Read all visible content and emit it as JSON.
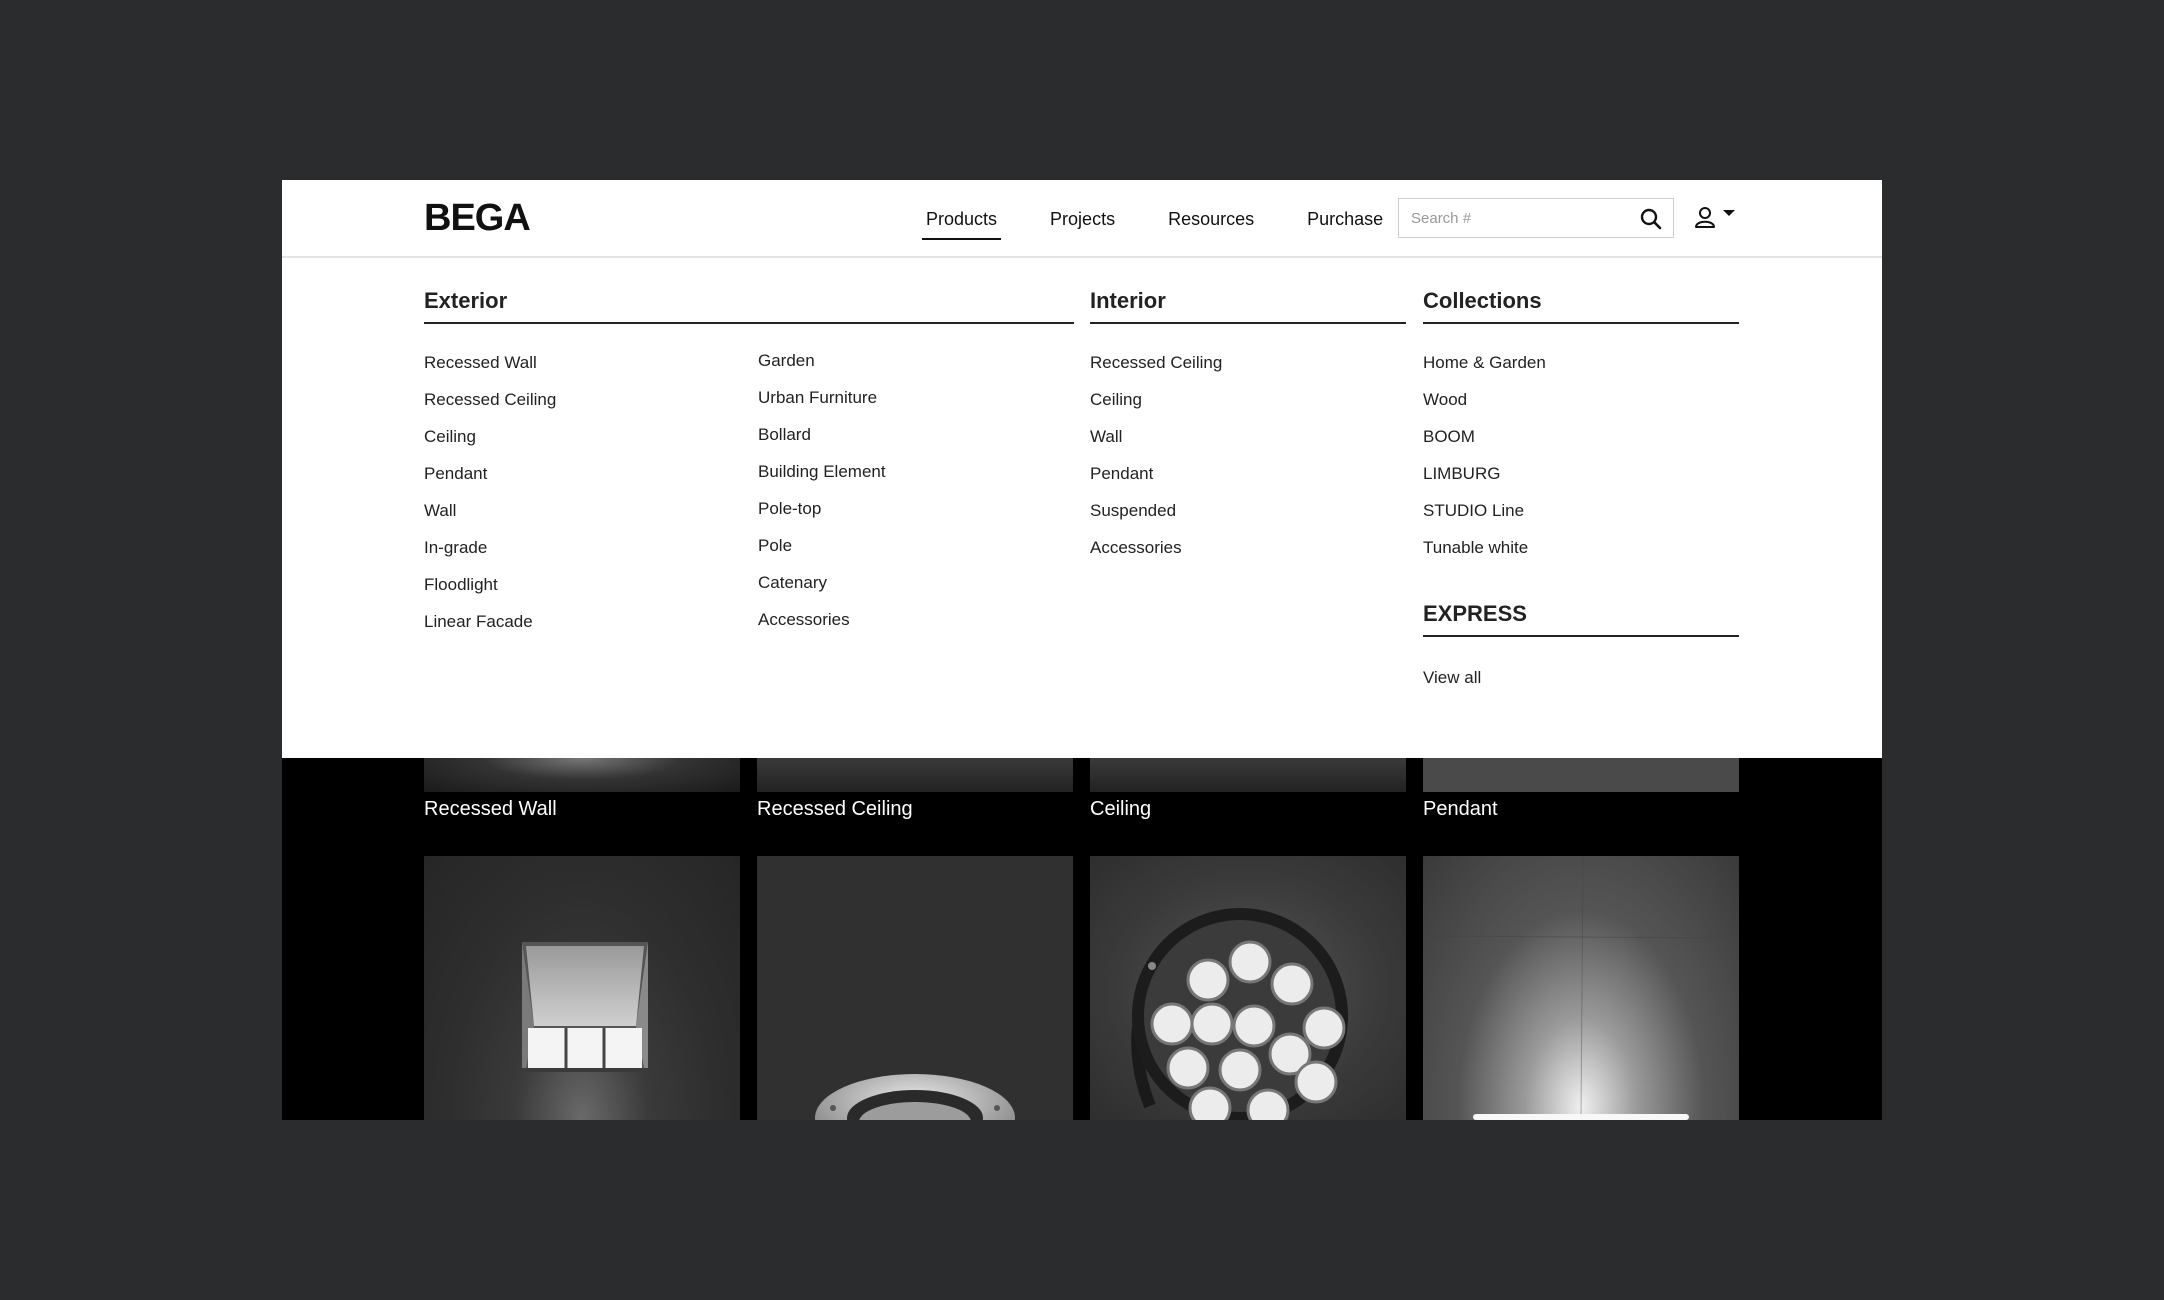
{
  "header": {
    "logo": "BEGA",
    "nav": [
      {
        "label": "Products",
        "active": true
      },
      {
        "label": "Projects",
        "active": false
      },
      {
        "label": "Resources",
        "active": false
      },
      {
        "label": "Purchase",
        "active": false
      }
    ],
    "search": {
      "placeholder": "Search #",
      "value": ""
    },
    "icons": {
      "search": "search-icon",
      "account": "user-icon",
      "dropdown": "caret-down-icon"
    }
  },
  "menu": {
    "exterior": {
      "title": "Exterior",
      "col1": [
        "Recessed Wall",
        "Recessed Ceiling",
        "Ceiling",
        "Pendant",
        "Wall",
        "In-grade",
        "Floodlight",
        "Linear Facade"
      ],
      "col2": [
        "Garden",
        "Urban Furniture",
        "Bollard",
        "Building Element",
        "Pole-top",
        "Pole",
        "Catenary",
        "Accessories"
      ]
    },
    "interior": {
      "title": "Interior",
      "items": [
        "Recessed Ceiling",
        "Ceiling",
        "Wall",
        "Pendant",
        "Suspended",
        "Accessories"
      ]
    },
    "collections": {
      "title": "Collections",
      "items": [
        "Home & Garden",
        "Wood",
        "BOOM",
        "LIMBURG",
        "STUDIO Line",
        "Tunable white"
      ]
    },
    "express": {
      "title": "EXPRESS",
      "items": [
        "View all"
      ]
    }
  },
  "tiles": {
    "labels": [
      "Recessed Wall",
      "Recessed Ceiling",
      "Ceiling",
      "Pendant"
    ]
  }
}
